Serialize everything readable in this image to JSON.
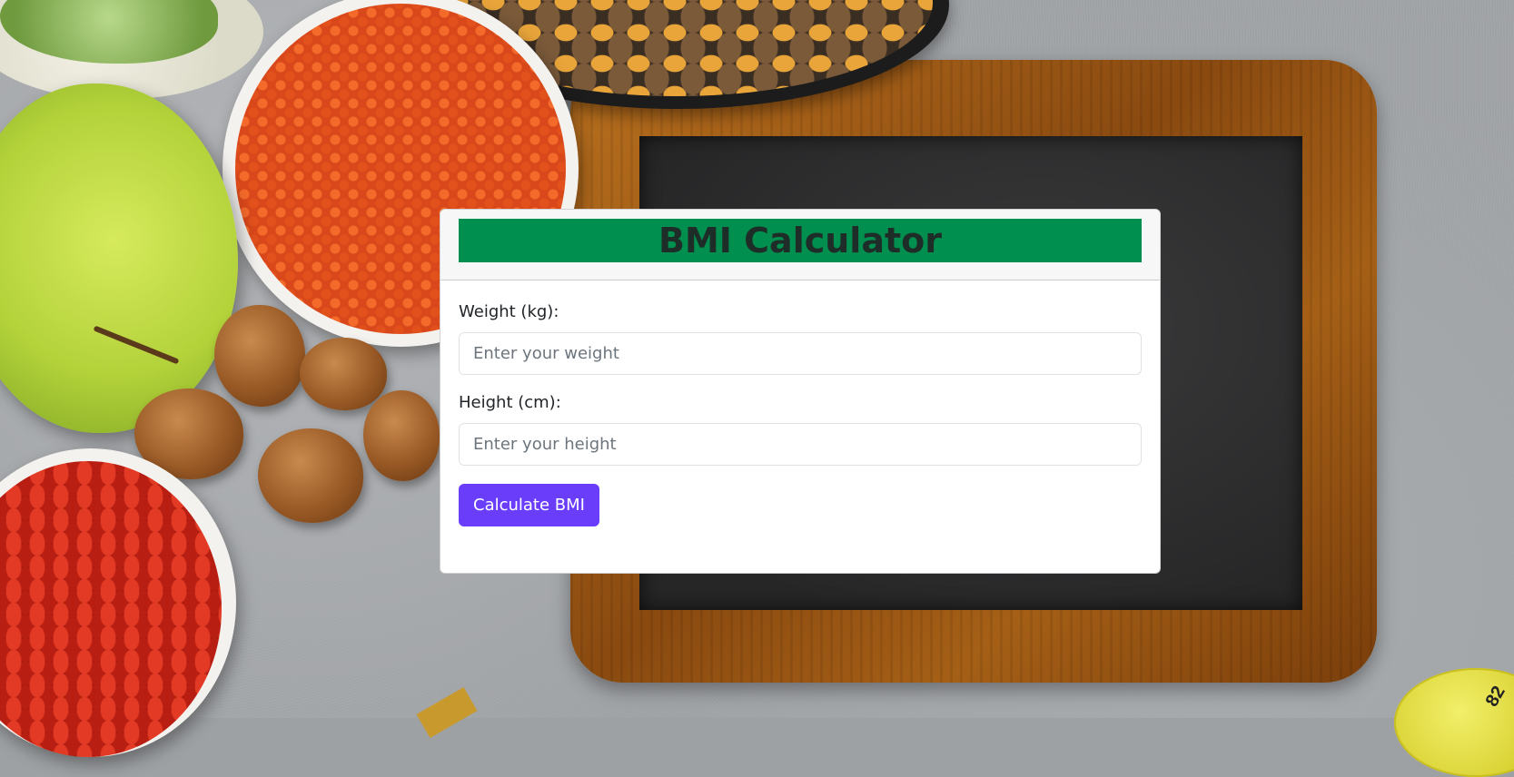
{
  "app": {
    "title": "BMI Calculator"
  },
  "form": {
    "weight": {
      "label": "Weight (kg):",
      "placeholder": "Enter your weight",
      "value": ""
    },
    "height": {
      "label": "Height (cm):",
      "placeholder": "Enter your height",
      "value": ""
    },
    "submit_label": "Calculate BMI"
  },
  "background": {
    "tape_mark": "82"
  },
  "colors": {
    "header_bar": "#008f4f",
    "title_text": "#1f2d29",
    "button": "#6a3dfb"
  }
}
